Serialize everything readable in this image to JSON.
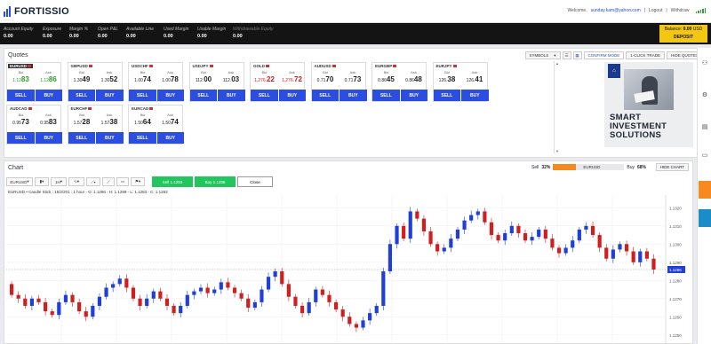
{
  "header": {
    "logo": "FORTISSIO",
    "welcome": "Welcome,",
    "email": "sunday.kam@yahoo.com",
    "links": [
      "Logout",
      "Withdraw"
    ]
  },
  "account": {
    "fields": [
      {
        "label": "Account Equity",
        "value": "0.00"
      },
      {
        "label": "Exposure",
        "value": "0.00"
      },
      {
        "label": "Margin %",
        "value": "0.00"
      },
      {
        "label": "Open P&L",
        "value": "0.00"
      },
      {
        "label": "Available Line",
        "value": "0.00"
      },
      {
        "label": "Used Margin",
        "value": "0.00"
      },
      {
        "label": "Usable Margin",
        "value": "0.00"
      },
      {
        "label": "Withdrawable Equity",
        "value": "0.00"
      }
    ],
    "balance_label": "Balance:",
    "balance_value": "0.00",
    "balance_currency": "USD",
    "deposit_label": "DEPOSIT"
  },
  "quotes": {
    "title": "Quotes",
    "toolbar": {
      "symbols": "SYMBOLS",
      "confirm_mode": "CONFIRM MODE",
      "one_click": "1-CLICK TRADE",
      "hide": "HIDE QUOTES"
    },
    "bid_label": "Bid",
    "ask_label": "Ask",
    "sell_label": "SELL",
    "buy_label": "BUY",
    "tiles": [
      {
        "symbol": "EURUSD",
        "bid_pre": "1.12",
        "bid_big": "83",
        "ask_pre": "1.12",
        "ask_big": "86",
        "trend": "up",
        "selected": true
      },
      {
        "symbol": "GBPUSD",
        "bid_pre": "1.30",
        "bid_big": "49",
        "ask_pre": "1.30",
        "ask_big": "52",
        "trend": "none",
        "selected": false
      },
      {
        "symbol": "USDCHF",
        "bid_pre": "1.00",
        "bid_big": "74",
        "ask_pre": "1.00",
        "ask_big": "78",
        "trend": "none",
        "selected": false
      },
      {
        "symbol": "USDJPY",
        "bid_pre": "112.",
        "bid_big": "00",
        "ask_pre": "112.",
        "ask_big": "03",
        "trend": "none",
        "selected": false
      },
      {
        "symbol": "GOLD",
        "bid_pre": "1,276.",
        "bid_big": "22",
        "ask_pre": "1,276.",
        "ask_big": "72",
        "trend": "down",
        "selected": false
      },
      {
        "symbol": "AUDUSD",
        "bid_pre": "0.71",
        "bid_big": "70",
        "ask_pre": "0.71",
        "ask_big": "73",
        "trend": "none",
        "selected": false
      },
      {
        "symbol": "EURGBP",
        "bid_pre": "0.86",
        "bid_big": "45",
        "ask_pre": "0.86",
        "ask_big": "48",
        "trend": "none",
        "selected": false
      },
      {
        "symbol": "EURJPY",
        "bid_pre": "126.",
        "bid_big": "38",
        "ask_pre": "126.",
        "ask_big": "41",
        "trend": "none",
        "selected": false
      },
      {
        "symbol": "AUDCAD",
        "bid_pre": "0.95",
        "bid_big": "73",
        "ask_pre": "0.95",
        "ask_big": "83",
        "trend": "none",
        "selected": false
      },
      {
        "symbol": "EURCHF",
        "bid_pre": "1.57",
        "bid_big": "28",
        "ask_pre": "1.57",
        "ask_big": "38",
        "trend": "none",
        "selected": false
      },
      {
        "symbol": "EURCAD",
        "bid_pre": "1.50",
        "bid_big": "64",
        "ask_pre": "1.50",
        "ask_big": "74",
        "trend": "none",
        "selected": false
      }
    ]
  },
  "ad": {
    "lines": [
      "SMART",
      "INVESTMENT",
      "SOLUTIONS"
    ]
  },
  "chart_panel": {
    "title": "Chart",
    "sell_label": "Sell",
    "sell_pct": "32%",
    "sell_fraction": 0.32,
    "sentiment_symbol": "EURUSD",
    "buy_label": "Buy",
    "buy_pct": "68%",
    "hide_label": "HIDE CHART",
    "toolbar": {
      "symbol": "EURUSD",
      "interval": "1H",
      "sell_btn": "Sell 1.1283",
      "buy_btn": "Buy 1.1286",
      "close_btn": "Close"
    },
    "info": "EURUSD • Candle Stick : 15/2/201 : 1 hour - O: 1.1286 - H: 1.1289 - L: 1.1283 - C: 1.1283"
  },
  "chart_data": {
    "type": "candlestick",
    "y_ticks": [
      "1.1320",
      "1.1310",
      "1.1300",
      "1.1290",
      "1.1280",
      "1.1270",
      "1.1260",
      "1.1250"
    ],
    "ylim": [
      1.1245,
      1.1327
    ],
    "current_price": "1.1286",
    "candles": [
      [
        1.1278,
        1.1272
      ],
      [
        1.1272,
        1.127
      ],
      [
        1.127,
        1.1266
      ],
      [
        1.1266,
        1.127
      ],
      [
        1.127,
        1.1268
      ],
      [
        1.1268,
        1.1263
      ],
      [
        1.1263,
        1.1261
      ],
      [
        1.1261,
        1.1268
      ],
      [
        1.1268,
        1.1272
      ],
      [
        1.1272,
        1.1268
      ],
      [
        1.1268,
        1.1263
      ],
      [
        1.1263,
        1.126
      ],
      [
        1.126,
        1.1266
      ],
      [
        1.1266,
        1.1271
      ],
      [
        1.1271,
        1.1276
      ],
      [
        1.1276,
        1.1278
      ],
      [
        1.1278,
        1.1281
      ],
      [
        1.1281,
        1.1276
      ],
      [
        1.1276,
        1.127
      ],
      [
        1.127,
        1.1266
      ],
      [
        1.1266,
        1.127
      ],
      [
        1.127,
        1.1274
      ],
      [
        1.1274,
        1.127
      ],
      [
        1.127,
        1.1266
      ],
      [
        1.1266,
        1.1262
      ],
      [
        1.1262,
        1.1266
      ],
      [
        1.1266,
        1.1272
      ],
      [
        1.1272,
        1.1274
      ],
      [
        1.1274,
        1.1276
      ],
      [
        1.1276,
        1.1273
      ],
      [
        1.1273,
        1.1275
      ],
      [
        1.1275,
        1.1279
      ],
      [
        1.1279,
        1.1276
      ],
      [
        1.1276,
        1.1273
      ],
      [
        1.1273,
        1.127
      ],
      [
        1.127,
        1.1265
      ],
      [
        1.1265,
        1.1268
      ],
      [
        1.1268,
        1.1275
      ],
      [
        1.1275,
        1.1282
      ],
      [
        1.1282,
        1.1285
      ],
      [
        1.1285,
        1.1278
      ],
      [
        1.1278,
        1.1271
      ],
      [
        1.1271,
        1.1266
      ],
      [
        1.1266,
        1.1262
      ],
      [
        1.1262,
        1.1268
      ],
      [
        1.1268,
        1.1275
      ],
      [
        1.1275,
        1.1272
      ],
      [
        1.1272,
        1.1268
      ],
      [
        1.1268,
        1.1264
      ],
      [
        1.1264,
        1.126
      ],
      [
        1.126,
        1.1256
      ],
      [
        1.1256,
        1.1254
      ],
      [
        1.1254,
        1.1258
      ],
      [
        1.1258,
        1.1262
      ],
      [
        1.1262,
        1.1266
      ],
      [
        1.1266,
        1.1285
      ],
      [
        1.1285,
        1.13
      ],
      [
        1.13,
        1.131
      ],
      [
        1.131,
        1.1303
      ],
      [
        1.1303,
        1.1318
      ],
      [
        1.1318,
        1.1314
      ],
      [
        1.1314,
        1.1307
      ],
      [
        1.1307,
        1.13
      ],
      [
        1.13,
        1.1296
      ],
      [
        1.1296,
        1.1298
      ],
      [
        1.1298,
        1.1303
      ],
      [
        1.1303,
        1.1308
      ],
      [
        1.1308,
        1.1313
      ],
      [
        1.1313,
        1.1316
      ],
      [
        1.1316,
        1.1318
      ],
      [
        1.1318,
        1.1312
      ],
      [
        1.1312,
        1.1305
      ],
      [
        1.1305,
        1.1302
      ],
      [
        1.1302,
        1.1306
      ],
      [
        1.1306,
        1.131
      ],
      [
        1.131,
        1.1306
      ],
      [
        1.1306,
        1.1302
      ],
      [
        1.1302,
        1.1304
      ],
      [
        1.1304,
        1.1308
      ],
      [
        1.1308,
        1.1303
      ],
      [
        1.1303,
        1.1298
      ],
      [
        1.1298,
        1.1295
      ],
      [
        1.1295,
        1.1298
      ],
      [
        1.1298,
        1.1302
      ],
      [
        1.1302,
        1.1308
      ],
      [
        1.1308,
        1.131
      ],
      [
        1.131,
        1.1305
      ],
      [
        1.1305,
        1.1298
      ],
      [
        1.1298,
        1.1292
      ],
      [
        1.1292,
        1.1297
      ],
      [
        1.1297,
        1.13
      ],
      [
        1.13,
        1.1296
      ],
      [
        1.1296,
        1.129
      ],
      [
        1.129,
        1.1296
      ],
      [
        1.1296,
        1.1292
      ],
      [
        1.1292,
        1.1286
      ]
    ]
  },
  "colors": {
    "accent_blue": "#2b4ee0",
    "balance_yellow": "#f3c611",
    "candle_up": "#1f3fd6",
    "candle_down": "#d21e1e",
    "trade_green": "#22c55e"
  }
}
